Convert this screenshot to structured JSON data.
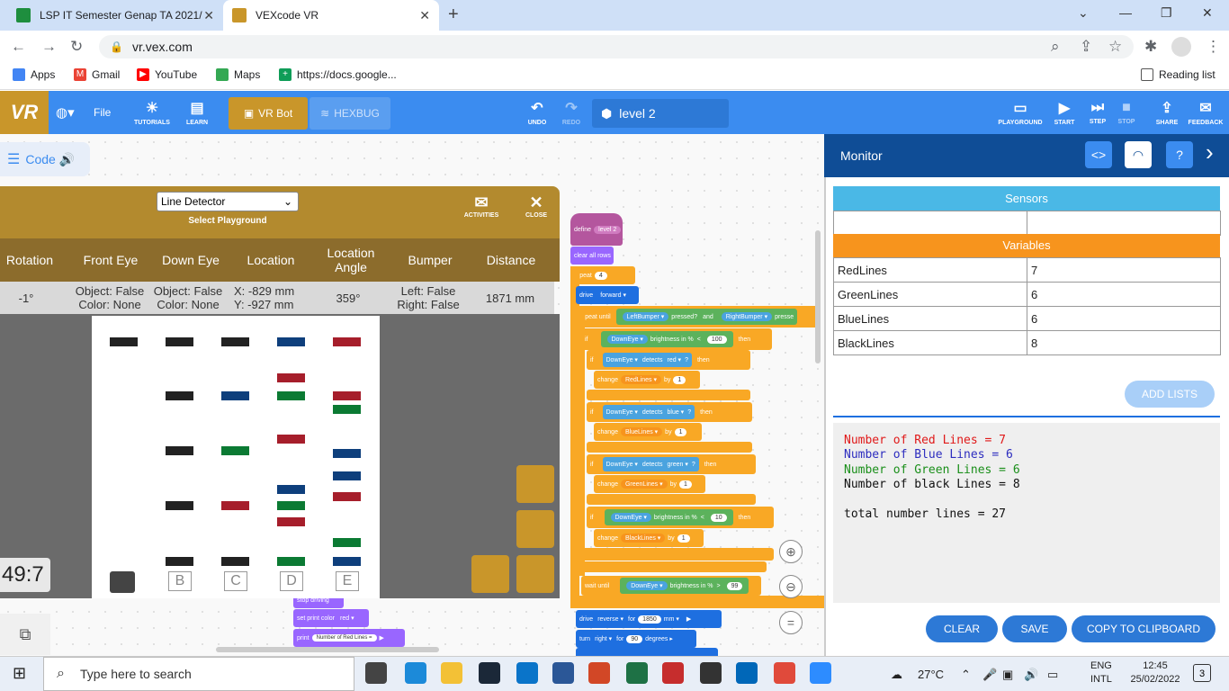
{
  "browser": {
    "tabs": [
      {
        "title": "LSP IT Semester Genap TA 2021/"
      },
      {
        "title": "VEXcode VR"
      }
    ],
    "url": "vr.vex.com",
    "bookmarks": [
      "Apps",
      "Gmail",
      "YouTube",
      "Maps",
      "https://docs.google..."
    ],
    "reading_list": "Reading list"
  },
  "header": {
    "logo": "VR",
    "file": "File",
    "tutorials": "TUTORIALS",
    "learn": "LEARN",
    "vrbot": "VR Bot",
    "hexbug": "HEXBUG",
    "undo": "UNDO",
    "redo": "REDO",
    "level": "level 2",
    "playground": "PLAYGROUND",
    "start": "START",
    "step": "STEP",
    "stop": "STOP",
    "share": "SHARE",
    "feedback": "FEEDBACK"
  },
  "code_tab": "Code",
  "playground": {
    "selected": "Line Detector",
    "select_label": "Select Playground",
    "activities": "ACTIVITIES",
    "close": "CLOSE",
    "columns": [
      "Rotation",
      "Front Eye",
      "Down Eye",
      "Location",
      "Location Angle",
      "Bumper",
      "Distance"
    ],
    "values": {
      "rotation": "-1°",
      "front_eye_1": "Object: False",
      "front_eye_2": "Color: None",
      "down_eye_1": "Object: False",
      "down_eye_2": "Color: None",
      "loc_1": "X: -829 mm",
      "loc_2": "Y: -927 mm",
      "angle": "359°",
      "bumper_1": "Left: False",
      "bumper_2": "Right: False",
      "distance": "1871 mm"
    },
    "timer": "49:7",
    "field_labels": [
      "B",
      "C",
      "D",
      "E"
    ]
  },
  "blocks": {
    "define": "define",
    "define_name": "level 2",
    "clear": "clear all rows",
    "repeat": "repeat",
    "repeat_n": "4",
    "drive": "drive",
    "forward": "forward ▾",
    "repeat_until": "repeat until",
    "left_bumper": "LeftBumper ▾",
    "pressed": "pressed?",
    "and": "and",
    "right_bumper": "RightBumper ▾",
    "pressed2": "presse",
    "if": "if",
    "then": "then",
    "down_eye": "DownEye ▾",
    "brightness": "brightness in %",
    "lt": "<",
    "gt": ">",
    "n100": "100",
    "n10": "10",
    "n99": "99",
    "detects": "detects",
    "red": "red ▾",
    "blue": "blue ▾",
    "green": "green ▾",
    "q": "?",
    "change": "change",
    "red_lines": "RedLines ▾",
    "blue_lines": "BlueLines ▾",
    "green_lines": "GreenLines ▾",
    "black_lines": "BlackLines ▾",
    "by": "by",
    "one": "1",
    "wait_until": "wait until",
    "reverse": "reverse ▾",
    "for": "for",
    "n1850": "1850",
    "mm": "mm ▾",
    "turn": "turn",
    "right": "right ▾",
    "n90": "90",
    "degrees": "degrees ▸",
    "stop_driving": "stop driving",
    "set_print": "set print color",
    "red2": "red ▾",
    "print": "print",
    "print_text": "Number of Red Lines ="
  },
  "monitor": {
    "title": "Monitor",
    "sensors": "Sensors",
    "variables": "Variables",
    "vars": [
      {
        "name": "RedLines",
        "value": "7"
      },
      {
        "name": "GreenLines",
        "value": "6"
      },
      {
        "name": "BlueLines",
        "value": "6"
      },
      {
        "name": "BlackLines",
        "value": "8"
      }
    ],
    "add_lists": "ADD LISTS",
    "console": [
      "Number of Red Lines = 7",
      "Number of Blue Lines = 6",
      "Number of Green Lines = 6",
      "Number of black Lines = 8",
      "",
      "total number lines = 27"
    ],
    "console_colors": [
      "#e01919",
      "#2d2dbf",
      "#1a8f1a",
      "#111",
      "#111",
      "#111"
    ],
    "clear": "CLEAR",
    "save": "SAVE",
    "copy": "COPY TO CLIPBOARD"
  },
  "taskbar": {
    "search": "Type here to search",
    "temp": "27°C",
    "lang1": "ENG",
    "lang2": "INTL",
    "time": "12:45",
    "date": "25/02/2022",
    "notif": "3"
  }
}
